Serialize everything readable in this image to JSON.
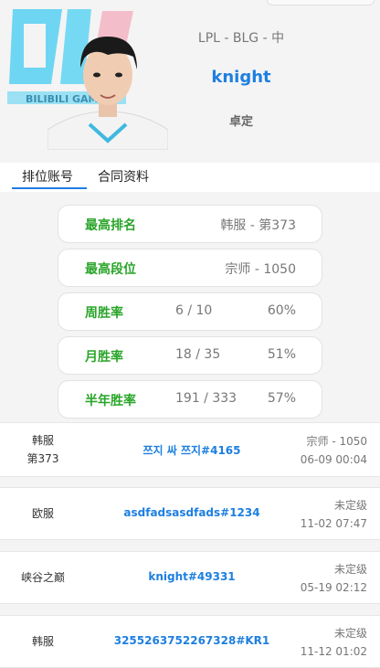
{
  "header": {
    "meta": "LPL - BLG - 中",
    "player_name": "knight",
    "status": "卓定"
  },
  "tabs": [
    {
      "label": "排位账号",
      "active": true
    },
    {
      "label": "合同资料",
      "active": false
    }
  ],
  "stats": {
    "highest_rank": {
      "label": "最高排名",
      "value": "韩服 - 第373"
    },
    "highest_tier": {
      "label": "最高段位",
      "value": "宗师 - 1050"
    },
    "week": {
      "label": "周胜率",
      "record": "6 / 10",
      "rate": "60%"
    },
    "month": {
      "label": "月胜率",
      "record": "18 / 35",
      "rate": "51%"
    },
    "half_year": {
      "label": "半年胜率",
      "record": "191 / 333",
      "rate": "57%"
    }
  },
  "accounts": [
    {
      "server": "韩服",
      "server_rank": "第373",
      "name": "쯔지 싸 쯔지#4165",
      "rank": "宗师 - 1050",
      "time": "06-09 00:04"
    },
    {
      "server": "欧服",
      "name": "asdfadsasdfads#1234",
      "rank": "未定级",
      "time": "11-02 07:47"
    },
    {
      "server": "峡谷之巅",
      "name": "knight#49331",
      "rank": "未定级",
      "time": "05-19 02:12"
    },
    {
      "server": "韩服",
      "name": "3255263752267328#KR1",
      "rank": "未定级",
      "time": "11-12 01:02"
    }
  ],
  "colors": {
    "accent_blue": "#1e7fe0",
    "stat_green": "#2aa52a",
    "logo_cyan": "#5fd3f2"
  },
  "images": {
    "logo": "bilibili-gaming-logo",
    "photo": "player-portrait"
  }
}
